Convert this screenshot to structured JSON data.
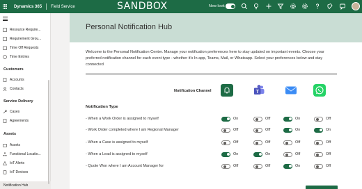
{
  "topbar": {
    "app_title": "Dynamics 365",
    "app_name": "Field Service",
    "environment": "SANDBOX",
    "new_look_label": "New look",
    "new_look_on": true
  },
  "sidebar": {
    "top_items": [
      {
        "label": "Resource Requirements"
      },
      {
        "label": "Requirement Groups"
      },
      {
        "label": "Time Off Requests"
      },
      {
        "label": "Time Entries"
      }
    ],
    "sections": [
      {
        "title": "Customers",
        "items": [
          {
            "label": "Accounts"
          },
          {
            "label": "Contacts"
          }
        ]
      },
      {
        "title": "Service Delivery",
        "items": [
          {
            "label": "Cases"
          },
          {
            "label": "Agreements"
          }
        ]
      },
      {
        "title": "Assets",
        "items": [
          {
            "label": "Assets"
          },
          {
            "label": "Functional Locations"
          },
          {
            "label": "IoT Alerts"
          },
          {
            "label": "IoT Devices"
          }
        ]
      }
    ],
    "active_item": "Notification Hub",
    "display": {
      "top_0": "Resource Require...",
      "top_1": "Requirement Grou...",
      "top_2": "Time Off Requests",
      "top_3": "Time Entries",
      "sec_0": "Customers",
      "sec_0_0": "Accounts",
      "sec_0_1": "Contacts",
      "sec_1": "Service Delivery",
      "sec_1_0": "Cases",
      "sec_1_1": "Agreements",
      "sec_2": "Assets",
      "sec_2_0": "Assets",
      "sec_2_1": "Functional Locatio...",
      "sec_2_2": "IoT Alerts",
      "sec_2_3": "IoT Devices"
    }
  },
  "main": {
    "title": "Personal Notification Hub",
    "intro": "Welcome to the Personal Notification Center. Manage your notification preferences here to stay updated on important events. Choose your preferred notification channel for each event type - whether it's In app, Teams, Mail, or Whatsapp. Select your preferences below and stay connected",
    "channel_label": "Notification Channel",
    "channels": [
      {
        "name": "In app",
        "icon": "bell-icon",
        "color": "#1d6b45"
      },
      {
        "name": "Teams",
        "icon": "teams-icon",
        "color": "#5b5fc7"
      },
      {
        "name": "Mail",
        "icon": "mail-icon",
        "color": "#2d7ff9"
      },
      {
        "name": "Whatsapp",
        "icon": "whatsapp-icon",
        "color": "#25d366"
      }
    ],
    "type_label": "Notification Type",
    "on_label": "On",
    "off_label": "Off",
    "rows": [
      {
        "label": "- When a Work Order is assigned to myself",
        "states": [
          true,
          false,
          true,
          false
        ]
      },
      {
        "label": "- Work Order completed where I am Regional Manager",
        "states": [
          false,
          false,
          true,
          true
        ]
      },
      {
        "label": "- When a Case is assigned to myself",
        "states": [
          false,
          false,
          false,
          false
        ]
      },
      {
        "label": "- When a Lead is assigned to myself",
        "states": [
          true,
          true,
          false,
          false
        ]
      },
      {
        "label": "- Quote Won where I am Account Manager for",
        "states": [
          false,
          false,
          true,
          false
        ]
      }
    ]
  },
  "colors": {
    "brand": "#1d6b45",
    "header_band": "#c9ddd4"
  }
}
